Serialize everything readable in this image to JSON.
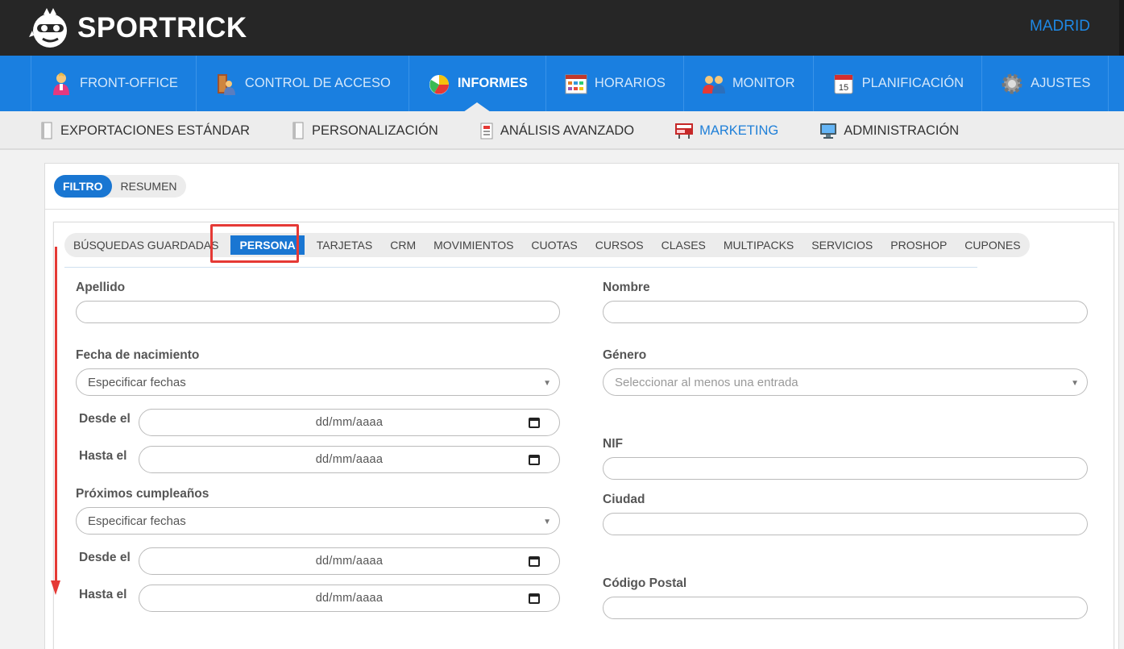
{
  "header": {
    "logo_text": "SPORTRICK",
    "city": "MADRID"
  },
  "main_nav": [
    {
      "label": "FRONT-OFFICE",
      "icon": "person-icon"
    },
    {
      "label": "CONTROL DE ACCESO",
      "icon": "access-door-icon"
    },
    {
      "label": "INFORMES",
      "icon": "pie-chart-icon",
      "active": true
    },
    {
      "label": "HORARIOS",
      "icon": "calendar-grid-icon"
    },
    {
      "label": "MONITOR",
      "icon": "people-group-icon"
    },
    {
      "label": "PLANIFICACIÓN",
      "icon": "calendar-15-icon"
    },
    {
      "label": "AJUSTES",
      "icon": "gear-icon"
    }
  ],
  "sub_nav": [
    {
      "label": "EXPORTACIONES ESTÁNDAR",
      "icon": "document-icon"
    },
    {
      "label": "PERSONALIZACIÓN",
      "icon": "document-icon"
    },
    {
      "label": "ANÁLISIS AVANZADO",
      "icon": "report-icon"
    },
    {
      "label": "MARKETING",
      "icon": "marketing-board-icon",
      "active": true
    },
    {
      "label": "ADMINISTRACIÓN",
      "icon": "monitor-icon"
    }
  ],
  "panel_tabs": [
    {
      "label": "FILTRO",
      "active": true
    },
    {
      "label": "RESUMEN"
    }
  ],
  "filter_tabs": [
    {
      "label": "BÚSQUEDAS GUARDADAS"
    },
    {
      "label": "PERSONA",
      "active": true
    },
    {
      "label": "TARJETAS"
    },
    {
      "label": "CRM"
    },
    {
      "label": "MOVIMIENTOS"
    },
    {
      "label": "CUOTAS"
    },
    {
      "label": "CURSOS"
    },
    {
      "label": "CLASES"
    },
    {
      "label": "MULTIPACKS"
    },
    {
      "label": "SERVICIOS"
    },
    {
      "label": "PROSHOP"
    },
    {
      "label": "CUPONES"
    }
  ],
  "form": {
    "apellido_label": "Apellido",
    "apellido_value": "",
    "nombre_label": "Nombre",
    "nombre_value": "",
    "fecha_nacimiento_label": "Fecha de nacimiento",
    "fecha_nacimiento_select": "Especificar fechas",
    "genero_label": "Género",
    "genero_placeholder": "Seleccionar al menos una entrada",
    "desde_label": "Desde el",
    "hasta_label": "Hasta el",
    "date_placeholder": "dd/mm/aaaa",
    "nif_label": "NIF",
    "nif_value": "",
    "proximos_label": "Próximos cumpleaños",
    "proximos_select": "Especificar fechas",
    "ciudad_label": "Ciudad",
    "ciudad_value": "",
    "codigo_postal_label": "Código Postal",
    "codigo_postal_value": ""
  },
  "colors": {
    "topbar": "#262626",
    "nav_blue": "#1a7fe0",
    "accent": "#1976d2",
    "annotation_red": "#e53935"
  }
}
